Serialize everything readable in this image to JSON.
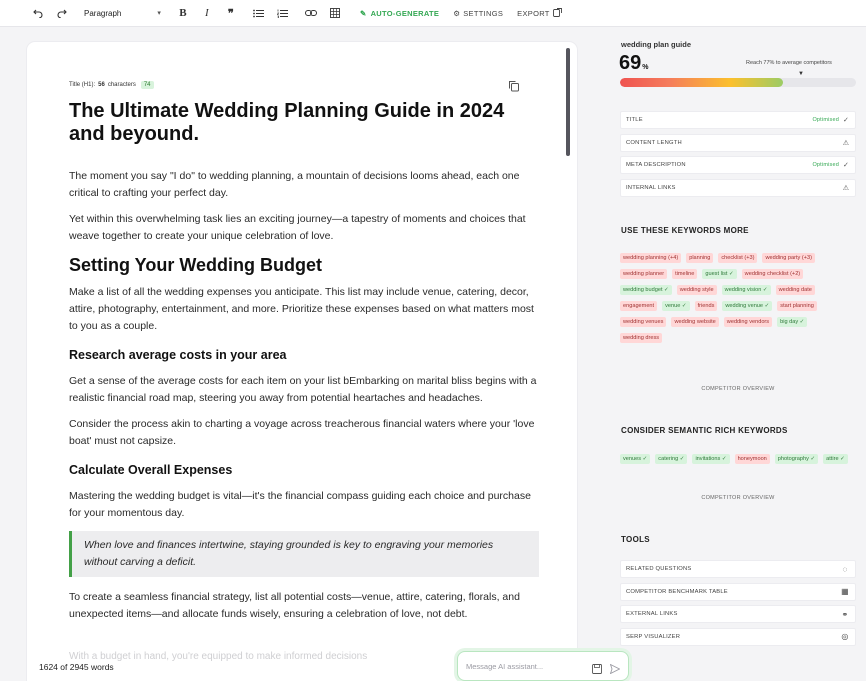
{
  "toolbar": {
    "paragraph_label": "Paragraph",
    "auto_generate": "AUTO-GENERATE",
    "settings": "SETTINGS",
    "export": "EXPORT"
  },
  "editor": {
    "title_meta": {
      "label": "Title (H1):",
      "count": "56",
      "unit": "characters",
      "badge": "74"
    },
    "title": "The Ultimate Wedding Planning Guide in 2024 and beyound.",
    "p1": "The moment you say \"I do\" to wedding planning, a mountain of decisions looms ahead, each one critical to crafting your perfect day.",
    "p2": "Yet within this overwhelming task lies an exciting journey—a tapestry of moments and choices that weave together to create your unique celebration of love.",
    "h2_budget": "Setting Your Wedding Budget",
    "p3": "Make a list of all the wedding expenses you anticipate. This list may include venue, catering, decor, attire, photography, entertainment, and more. Prioritize these expenses based on what matters most to you as a couple.",
    "h3_research": "Research average costs in your area",
    "p4": "Get a sense of the average costs for each item on your list bEmbarking on marital bliss begins with a realistic financial road map, steering you away from potential heartaches and headaches.",
    "p5": "Consider the process akin to charting a voyage across treacherous financial waters where your 'love boat' must not capsize.",
    "h3_calc": "Calculate Overall Expenses",
    "p6": "Mastering the wedding budget is vital—it's the financial compass guiding each choice and purchase for your momentous day.",
    "quote": "When love and finances intertwine, staying grounded is key to engraving your memories without carving a deficit.",
    "p7": "To create a seamless financial strategy, list all potential costs—venue, attire, catering, florals, and unexpected items—and allocate funds wisely, ensuring a celebration of love, not debt.",
    "faded": "With a budget in hand, you're equipped to make informed decisions",
    "word_count": "1624 of 2945 words",
    "message_placeholder": "Message AI assistant..."
  },
  "sidebar": {
    "plan_name": "wedding plan guide",
    "score": "69",
    "score_unit": "%",
    "score_fraction": 0.69,
    "reach_text": "Reach 77% to average competitors",
    "checks": [
      {
        "label": "TITLE",
        "status": "Optimised",
        "icon": "check-icon"
      },
      {
        "label": "CONTENT LENGTH",
        "status": "",
        "icon": "warning-icon"
      },
      {
        "label": "META DESCRIPTION",
        "status": "Optimised",
        "icon": "check-icon"
      },
      {
        "label": "INTERNAL LINKS",
        "status": "",
        "icon": "warning-icon"
      }
    ],
    "keywords_title": "USE THESE KEYWORDS MORE",
    "keywords": [
      {
        "text": "wedding planning (+4)",
        "state": "red"
      },
      {
        "text": "planning",
        "state": "red"
      },
      {
        "text": "checklist (+3)",
        "state": "red"
      },
      {
        "text": "wedding party (+3)",
        "state": "red"
      },
      {
        "text": "wedding planner",
        "state": "red"
      },
      {
        "text": "timeline",
        "state": "red"
      },
      {
        "text": "guest list ✓",
        "state": "green"
      },
      {
        "text": "wedding checklist (+2)",
        "state": "red"
      },
      {
        "text": "wedding budget ✓",
        "state": "green"
      },
      {
        "text": "wedding style",
        "state": "red"
      },
      {
        "text": "wedding vision ✓",
        "state": "green"
      },
      {
        "text": "wedding date",
        "state": "red"
      },
      {
        "text": "engagement",
        "state": "red"
      },
      {
        "text": "venue ✓",
        "state": "green"
      },
      {
        "text": "friends",
        "state": "red"
      },
      {
        "text": "wedding venue ✓",
        "state": "green"
      },
      {
        "text": "start planning",
        "state": "red"
      },
      {
        "text": "wedding venues",
        "state": "red"
      },
      {
        "text": "wedding website",
        "state": "red"
      },
      {
        "text": "wedding vendors",
        "state": "red"
      },
      {
        "text": "big day ✓",
        "state": "green"
      },
      {
        "text": "wedding dress",
        "state": "red"
      }
    ],
    "competitor_overview": "COMPETITOR OVERVIEW",
    "semantic_title": "CONSIDER SEMANTIC RICH KEYWORDS",
    "semantic_keywords": [
      {
        "text": "venues ✓",
        "state": "green"
      },
      {
        "text": "catering ✓",
        "state": "green"
      },
      {
        "text": "invitations ✓",
        "state": "green"
      },
      {
        "text": "honeymoon",
        "state": "red"
      },
      {
        "text": "photography ✓",
        "state": "green"
      },
      {
        "text": "attire ✓",
        "state": "green"
      }
    ],
    "tools_title": "TOOLS",
    "tools": [
      {
        "label": "RELATED QUESTIONS",
        "icon": "question-icon"
      },
      {
        "label": "COMPETITOR BENCHMARK TABLE",
        "icon": "table-icon"
      },
      {
        "label": "EXTERNAL LINKS",
        "icon": "link-icon"
      },
      {
        "label": "SERP VISUALIZER",
        "icon": "target-icon"
      }
    ]
  }
}
